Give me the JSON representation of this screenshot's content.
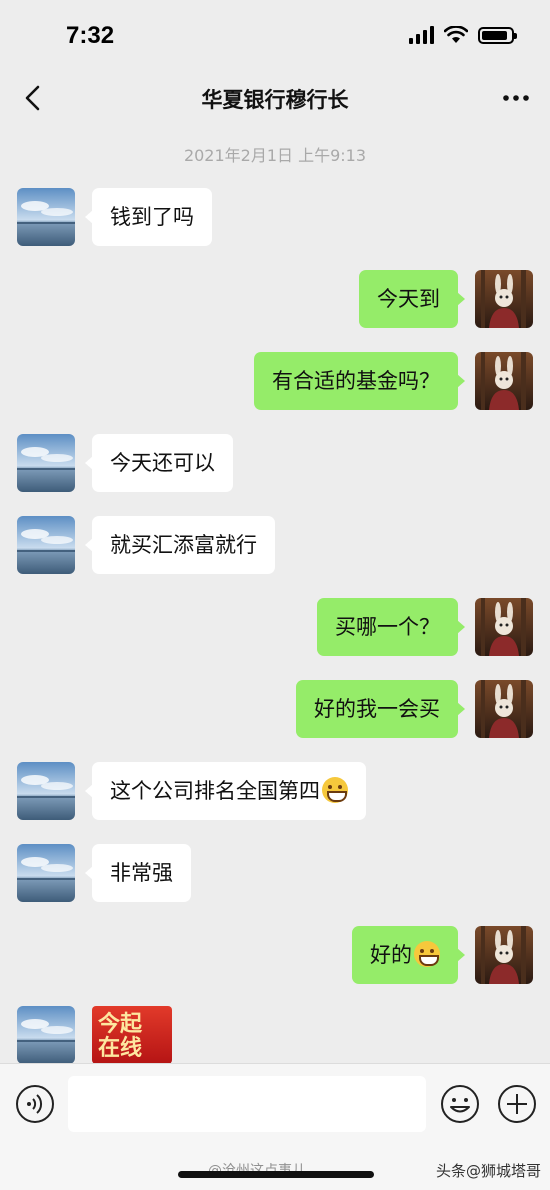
{
  "status_bar": {
    "time": "7:32",
    "battery_level": 0.9
  },
  "nav": {
    "title": "华夏银行穆行长"
  },
  "timestamp": "2021年2月1日 上午9:13",
  "messages": [
    {
      "side": "left",
      "text": "钱到了吗"
    },
    {
      "side": "right",
      "text": "今天到"
    },
    {
      "side": "right",
      "text": "有合适的基金吗？"
    },
    {
      "side": "left",
      "text": "今天还可以"
    },
    {
      "side": "left",
      "text": "就买汇添富就行"
    },
    {
      "side": "right",
      "text": "买哪一个？"
    },
    {
      "side": "right",
      "text": "好的我一会买"
    },
    {
      "side": "left",
      "text": "这个公司排名全国第四",
      "emoji": "grinning-face"
    },
    {
      "side": "left",
      "text": "非常强"
    },
    {
      "side": "right",
      "text": "好的",
      "emoji": "grinning-face"
    },
    {
      "side": "left",
      "type": "image",
      "text": "今起\n在线"
    }
  ],
  "input": {
    "placeholder": ""
  },
  "watermarks": {
    "center": "@沧州这点事儿",
    "right": "头条@狮城塔哥"
  },
  "colors": {
    "background": "#ededed",
    "bubble_left": "#ffffff",
    "bubble_right": "#95ec69"
  }
}
